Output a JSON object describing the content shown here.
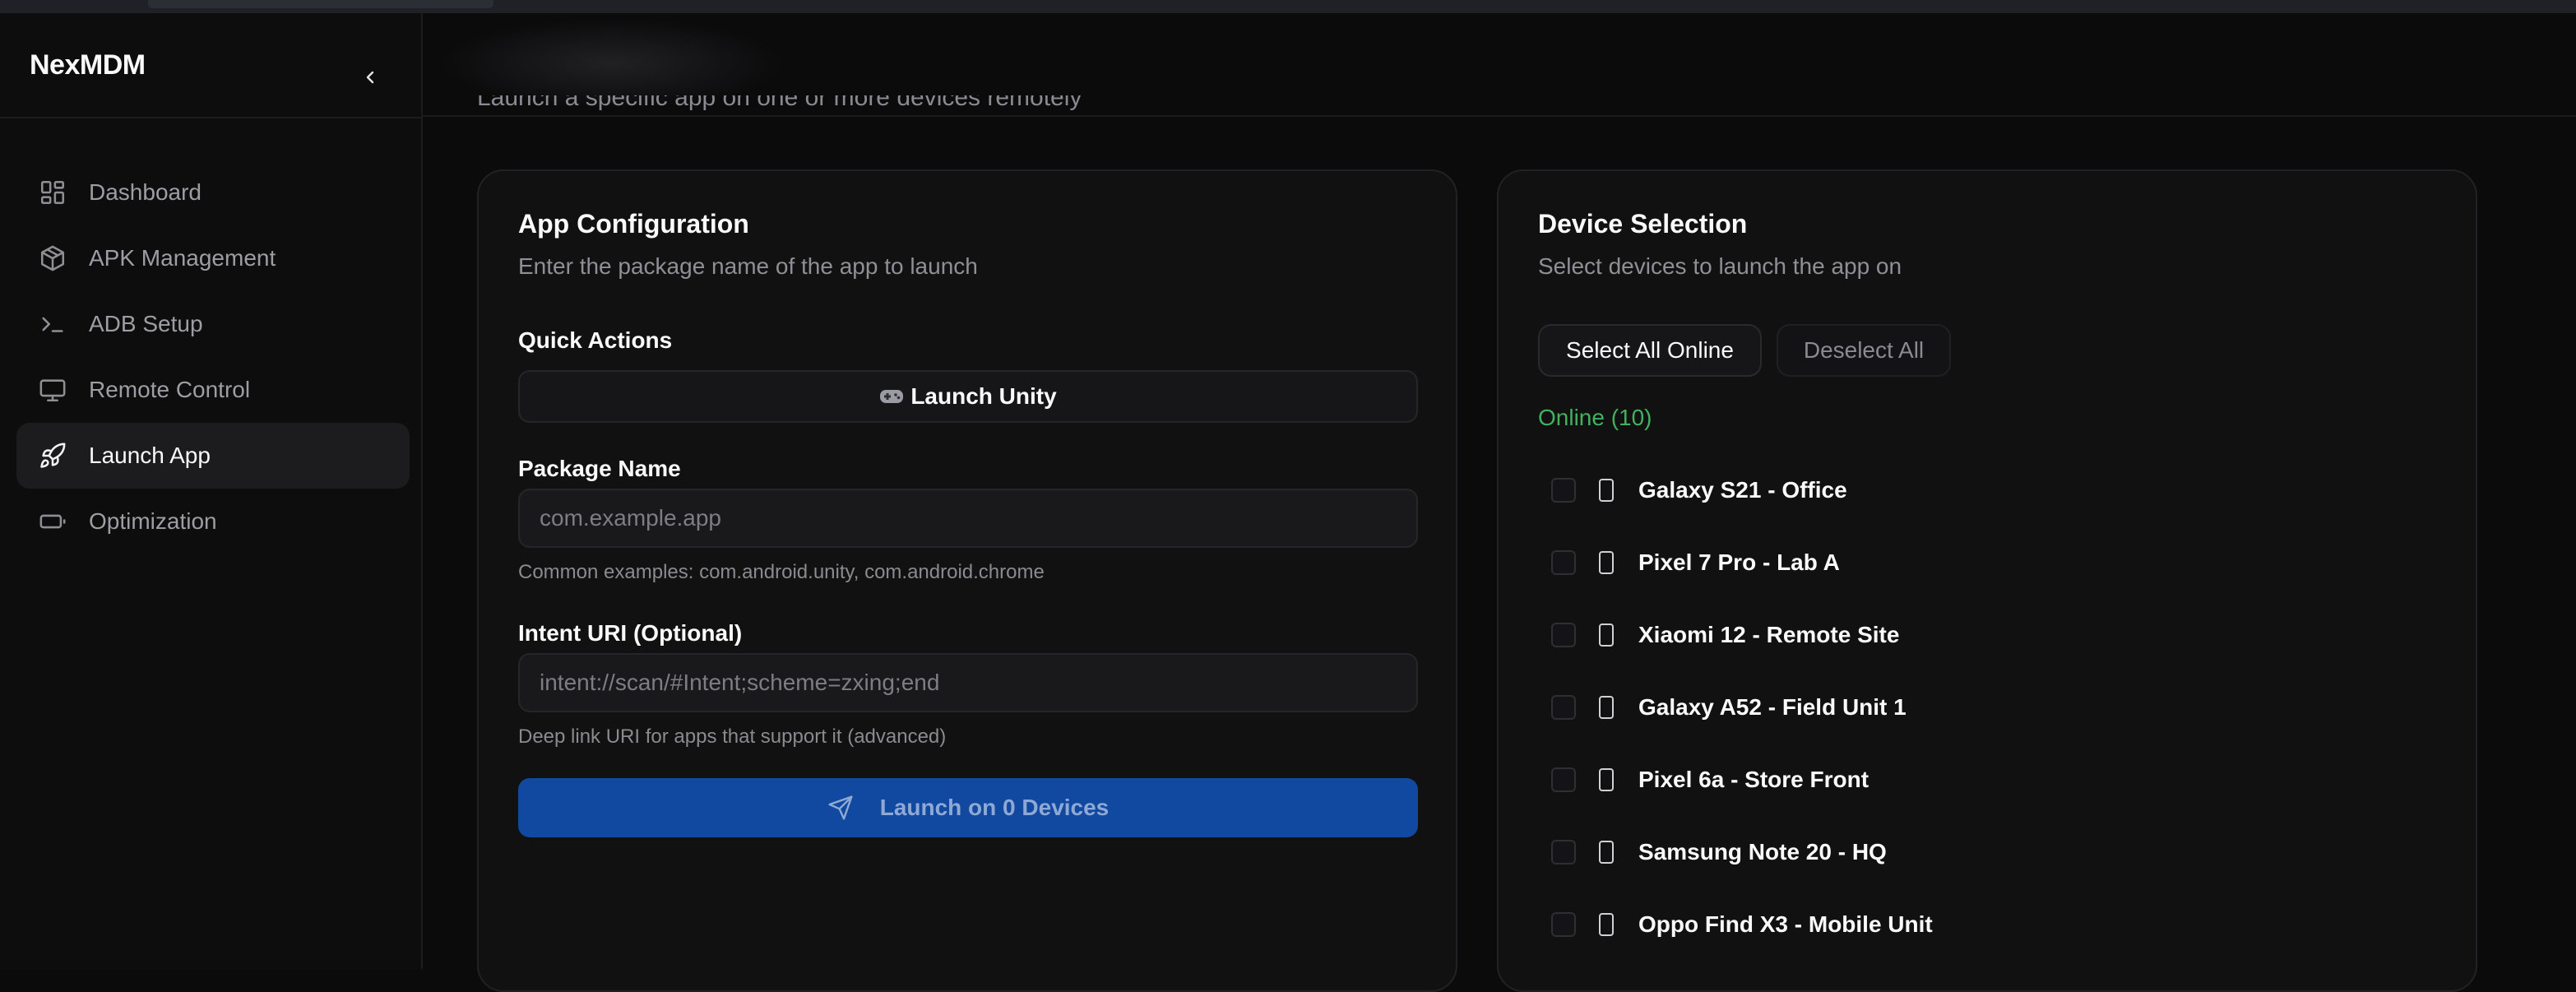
{
  "app": {
    "brand": "NexMDM"
  },
  "sidebar": {
    "items": [
      {
        "label": "Dashboard",
        "icon": "dashboard-icon"
      },
      {
        "label": "APK Management",
        "icon": "package-icon"
      },
      {
        "label": "ADB Setup",
        "icon": "terminal-icon"
      },
      {
        "label": "Remote Control",
        "icon": "monitor-icon"
      },
      {
        "label": "Launch App",
        "icon": "rocket-icon",
        "active": true
      },
      {
        "label": "Optimization",
        "icon": "battery-icon"
      }
    ]
  },
  "page": {
    "subtitle": "Launch a specific app on one or more devices remotely"
  },
  "app_config": {
    "title": "App Configuration",
    "description": "Enter the package name of the app to launch",
    "quick_actions_label": "Quick Actions",
    "launch_unity_label": "Launch Unity",
    "package_label": "Package Name",
    "package_placeholder": "com.example.app",
    "package_hint": "Common examples: com.android.unity, com.android.chrome",
    "intent_label": "Intent URI (Optional)",
    "intent_placeholder": "intent://scan/#Intent;scheme=zxing;end",
    "intent_hint": "Deep link URI for apps that support it (advanced)",
    "launch_button": "Launch on 0 Devices"
  },
  "device_selection": {
    "title": "Device Selection",
    "description": "Select devices to launch the app on",
    "select_all": "Select All Online",
    "deselect_all": "Deselect All",
    "online_label": "Online (10)",
    "devices": [
      "Galaxy S21 - Office",
      "Pixel 7 Pro - Lab A",
      "Xiaomi 12 - Remote Site",
      "Galaxy A52 - Field Unit 1",
      "Pixel 6a - Store Front",
      "Samsung Note 20 - HQ",
      "Oppo Find X3 - Mobile Unit"
    ]
  },
  "colors": {
    "accent": "#1149a0",
    "online": "#41b15f",
    "background": "#0b0b0c"
  }
}
